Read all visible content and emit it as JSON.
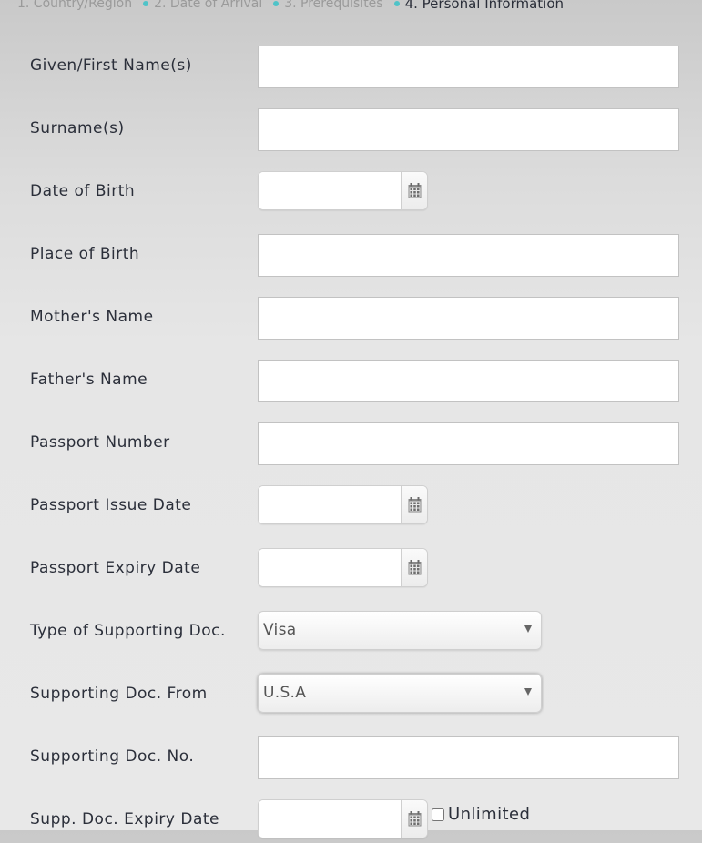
{
  "steps": [
    {
      "label": "1. Country/Region",
      "active": false
    },
    {
      "label": "2. Date of Arrival",
      "active": false
    },
    {
      "label": "3. Prerequisites",
      "active": false
    },
    {
      "label": "4. Personal Information",
      "active": true
    }
  ],
  "form": {
    "given_name": {
      "label": "Given/First Name(s)",
      "value": ""
    },
    "surname": {
      "label": "Surname(s)",
      "value": ""
    },
    "date_of_birth": {
      "label": "Date of Birth",
      "value": ""
    },
    "place_of_birth": {
      "label": "Place of Birth",
      "value": ""
    },
    "mothers_name": {
      "label": "Mother's Name",
      "value": ""
    },
    "fathers_name": {
      "label": "Father's Name",
      "value": ""
    },
    "passport_number": {
      "label": "Passport Number",
      "value": ""
    },
    "passport_issue_date": {
      "label": "Passport Issue Date",
      "value": ""
    },
    "passport_expiry_date": {
      "label": "Passport Expiry Date",
      "value": ""
    },
    "supporting_doc_type": {
      "label": "Type of Supporting Doc.",
      "selected": "Visa"
    },
    "supporting_doc_from": {
      "label": "Supporting Doc. From",
      "selected": "U.S.A"
    },
    "supporting_doc_no": {
      "label": "Supporting Doc. No.",
      "value": ""
    },
    "supp_doc_expiry_date": {
      "label": "Supp. Doc. Expiry Date",
      "value": "",
      "unlimited_label": "Unlimited",
      "unlimited_checked": false
    }
  },
  "icons": {
    "calendar": "calendar-icon",
    "dropdown": "chevron-down-icon"
  },
  "colors": {
    "step_dot": "#4fc3c8",
    "label_text": "#2b2f3a",
    "step_inactive": "#9a9a9a"
  }
}
